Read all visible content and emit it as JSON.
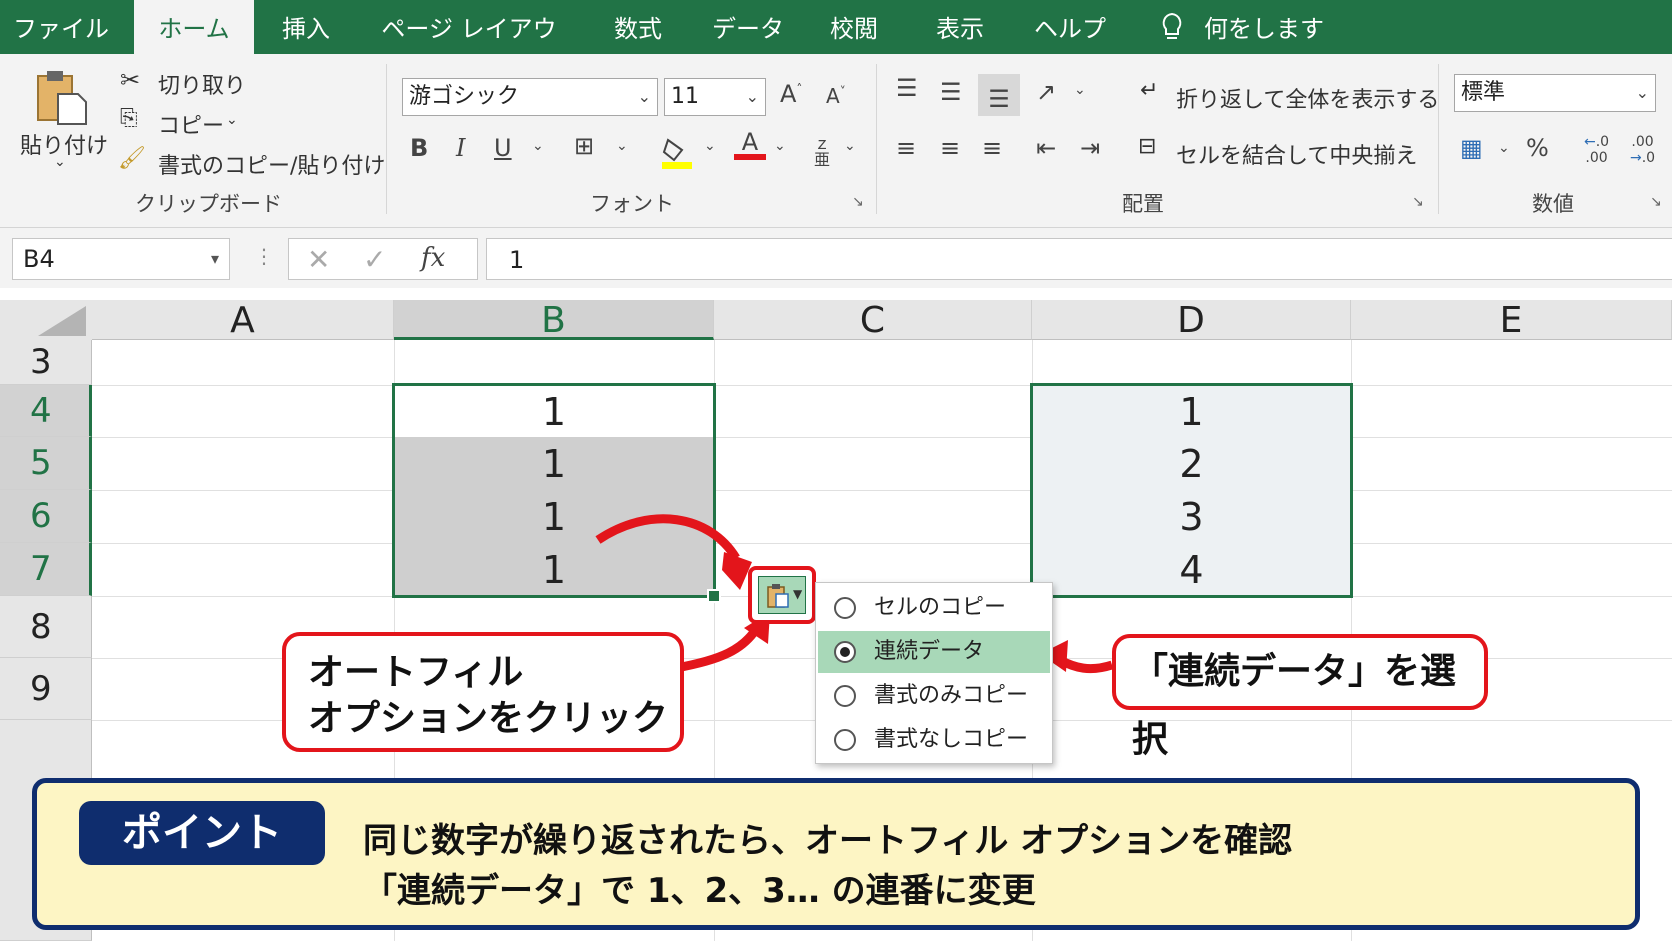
{
  "tabs": [
    "ファイル",
    "ホーム",
    "挿入",
    "ページ レイアウト",
    "数式",
    "データ",
    "校閲",
    "表示",
    "ヘルプ"
  ],
  "tell_me": "何をしますか",
  "clipboard": {
    "paste": "貼り付け",
    "cut": "切り取り",
    "copy": "コピー",
    "format_painter": "書式のコピー/貼り付け",
    "label": "クリップボード"
  },
  "font": {
    "name": "游ゴシック",
    "size": "11",
    "label": "フォント",
    "bold": "B",
    "italic": "I",
    "underline": "U",
    "font_color_glyph": "A",
    "grow_glyph": "A",
    "shrink_glyph": "A",
    "phonetic_glyph": "亜"
  },
  "alignment": {
    "wrap": "折り返して全体を表示する",
    "merge": "セルを結合して中央揃え",
    "label": "配置"
  },
  "number": {
    "format": "標準",
    "percent": "%",
    "inc_decimal": ".00",
    "dec_decimal": ".00",
    "label": "数値"
  },
  "formula_bar": {
    "name_box": "B4",
    "formula": "1",
    "fx": "fx"
  },
  "columns": [
    "A",
    "B",
    "C",
    "D",
    "E"
  ],
  "rows": [
    "3",
    "4",
    "5",
    "6",
    "7",
    "8",
    "9"
  ],
  "col_b_values": [
    "1",
    "1",
    "1",
    "1"
  ],
  "col_d_values": [
    "1",
    "2",
    "3",
    "4"
  ],
  "autofill_menu": [
    "セルのコピー",
    "連続データ",
    "書式のみコピー",
    "書式なしコピー"
  ],
  "callout_left": [
    "オートフィル",
    "オプションをクリック"
  ],
  "callout_right": "「連続データ」を選択",
  "point": {
    "badge": "ポイント",
    "line1": "同じ数字が繰り返されたら、オートフィル オプションを確認",
    "line2": "「連続データ」で 1、2、3… の連番に変更"
  },
  "colors": {
    "excel_green": "#217346",
    "callout_red": "#e3151b",
    "point_navy": "#0f2d6e",
    "point_bg": "#fdf5c4",
    "menu_highlight": "#a8d8b8"
  }
}
